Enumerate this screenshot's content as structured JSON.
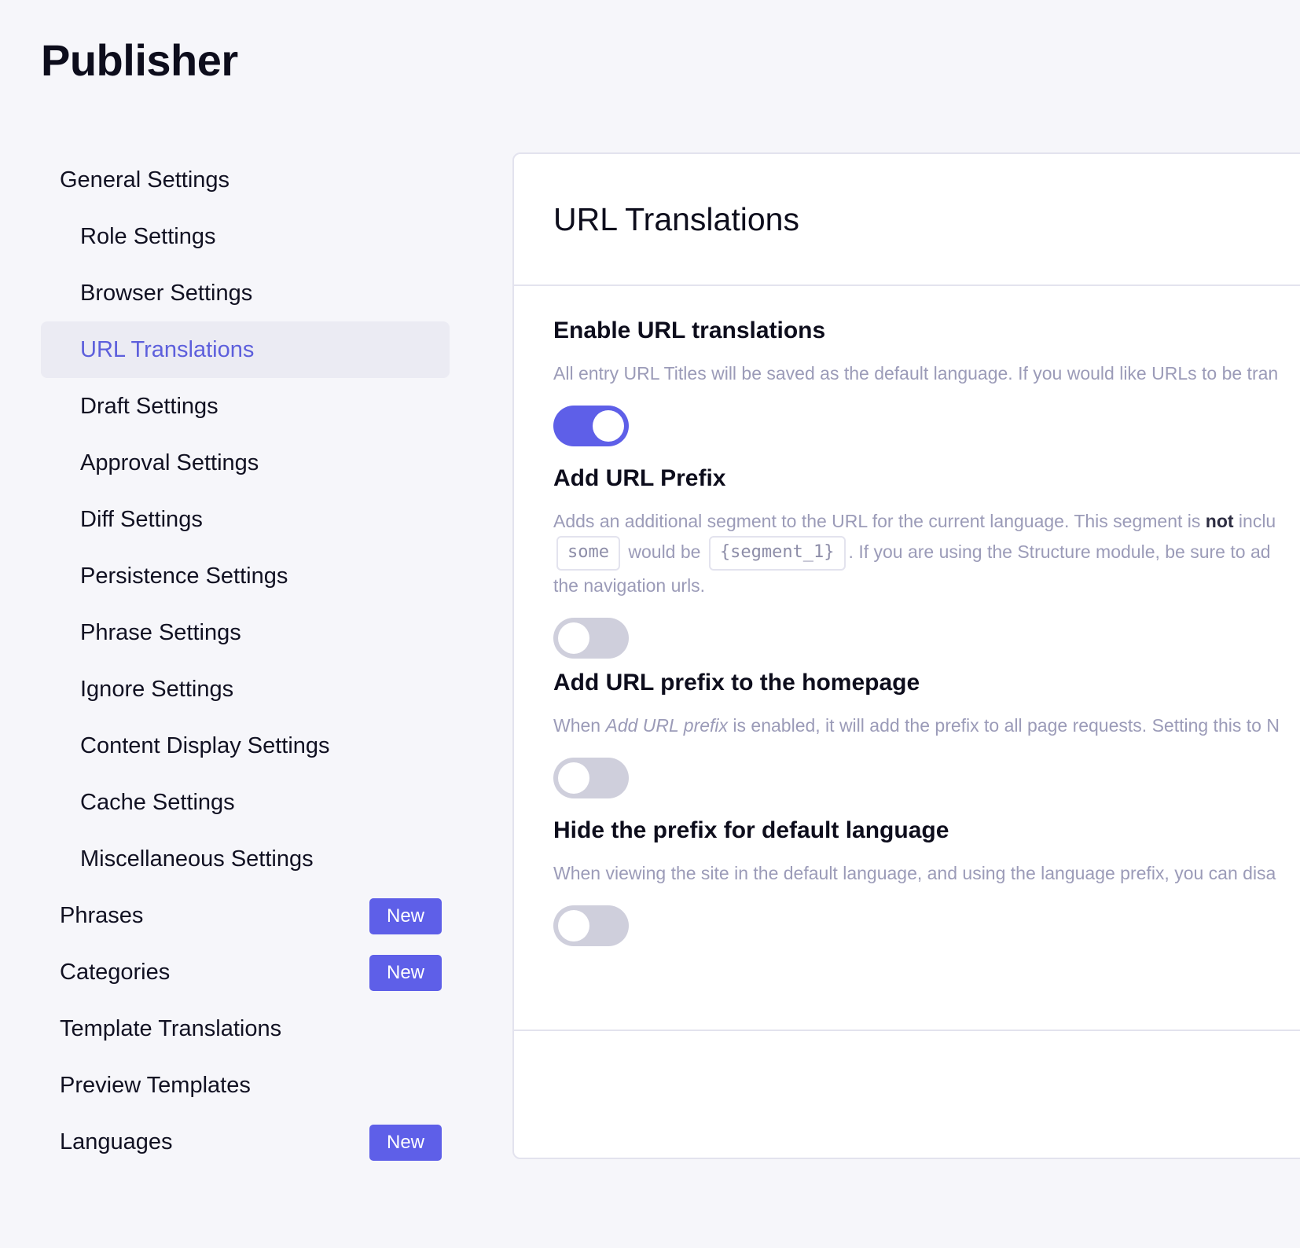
{
  "app": {
    "title": "Publisher"
  },
  "sidebar": {
    "items": [
      {
        "label": "General Settings"
      },
      {
        "label": "Role Settings"
      },
      {
        "label": "Browser Settings"
      },
      {
        "label": "URL Translations"
      },
      {
        "label": "Draft Settings"
      },
      {
        "label": "Approval Settings"
      },
      {
        "label": "Diff Settings"
      },
      {
        "label": "Persistence Settings"
      },
      {
        "label": "Phrase Settings"
      },
      {
        "label": "Ignore Settings"
      },
      {
        "label": "Content Display Settings"
      },
      {
        "label": "Cache Settings"
      },
      {
        "label": "Miscellaneous Settings"
      },
      {
        "label": "Phrases",
        "badge": "New"
      },
      {
        "label": "Categories",
        "badge": "New"
      },
      {
        "label": "Template Translations"
      },
      {
        "label": "Preview Templates"
      },
      {
        "label": "Languages",
        "badge": "New"
      }
    ],
    "active_item": "URL Translations"
  },
  "panel": {
    "title": "URL Translations",
    "fields": [
      {
        "label": "Enable URL translations",
        "description": "All entry URL Titles will be saved as the default language. If you would like URLs to be tran",
        "enabled": true
      },
      {
        "label": "Add URL Prefix",
        "description_part1": "Adds an additional segment to the URL for the current language. This segment is ",
        "description_bold": "not",
        "description_part2": " inclu",
        "code_1": "some",
        "would_be": "would be",
        "code_2": "{segment_1}",
        "description_part3": ". If you are using the Structure module, be sure to ad",
        "description_line3": "the navigation urls.",
        "enabled": false
      },
      {
        "label": "Add URL prefix to the homepage",
        "description_pre": "When ",
        "description_italic": "Add URL prefix",
        "description_post": " is enabled, it will add the prefix to all page requests. Setting this to N",
        "enabled": false
      },
      {
        "label": "Hide the prefix for default language",
        "description": "When viewing the site in the default language, and using the language prefix, you can disa",
        "enabled": false
      }
    ]
  },
  "colors": {
    "accent": "#5e5fe8",
    "active_text": "#5d5fdc",
    "active_bg": "#ebebf3",
    "toggle_off": "#cfcfdc",
    "muted_text": "#9b9bb8",
    "page_bg": "#f6f6fa"
  }
}
